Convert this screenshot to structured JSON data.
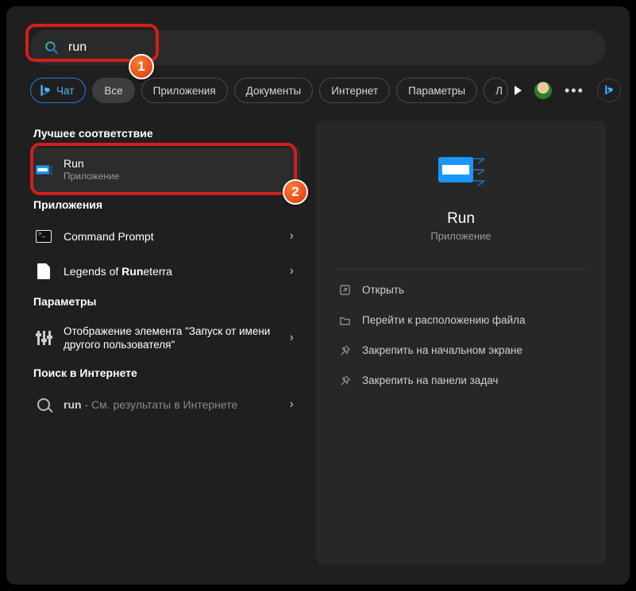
{
  "search": {
    "value": "run"
  },
  "filters": {
    "chat": "Чат",
    "all": "Все",
    "apps": "Приложения",
    "docs": "Документы",
    "web": "Интернет",
    "settings": "Параметры",
    "more_cut": "Л"
  },
  "sections": {
    "best_match": "Лучшее соответствие",
    "apps": "Приложения",
    "settings": "Параметры",
    "web": "Поиск в Интернете"
  },
  "best": {
    "title": "Run",
    "subtitle": "Приложение"
  },
  "apps_list": [
    {
      "label": "Command Prompt"
    },
    {
      "label_prefix": "Legends of ",
      "label_match": "Run",
      "label_suffix": "eterra"
    }
  ],
  "settings_list": [
    {
      "label": "Отображение элемента \"Запуск от имени другого пользователя\""
    }
  ],
  "web_list": [
    {
      "prefix": "run",
      "suffix": " - См. результаты в Интернете"
    }
  ],
  "preview": {
    "title": "Run",
    "subtitle": "Приложение",
    "actions": {
      "open": "Открыть",
      "file_location": "Перейти к расположению файла",
      "pin_start": "Закрепить на начальном экране",
      "pin_taskbar": "Закрепить на панели задач"
    }
  },
  "annotations": {
    "step1": "1",
    "step2": "2"
  }
}
